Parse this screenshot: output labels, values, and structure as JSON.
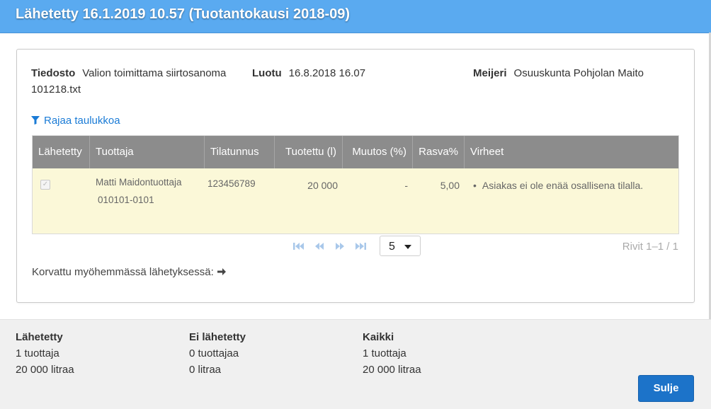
{
  "header": {
    "title": "Lähetetty 16.1.2019 10.57 (Tuotantokausi 2018-09)"
  },
  "meta": {
    "file_label": "Tiedosto",
    "file_value_line1": "Valion toimittama siirtosanoma",
    "file_value_line2": "101218.txt",
    "created_label": "Luotu",
    "created_value": "16.8.2018 16.07",
    "dairy_label": "Meijeri",
    "dairy_value": "Osuuskunta Pohjolan Maito"
  },
  "filter": {
    "label": "Rajaa taulukkoa",
    "icon": "filter-icon"
  },
  "table": {
    "columns": [
      "Lähetetty",
      "Tuottaja",
      "Tilatunnus",
      "Tuotettu (l)",
      "Muutos (%)",
      "Rasva%",
      "Virheet"
    ],
    "rows": [
      {
        "sent_checked": true,
        "producer_name": "Matti Maidontuottaja",
        "producer_id": "010101-0101",
        "farm_id": "123456789",
        "produced": "20 000",
        "change": "-",
        "fat": "5,00",
        "error": "Asiakas ei ole enää osallisena tilalla."
      }
    ]
  },
  "pager": {
    "page_size": "5",
    "rows_info": "Rivit 1–1 / 1",
    "icons": [
      "first-page-icon",
      "prev-page-icon",
      "next-page-icon",
      "last-page-icon"
    ]
  },
  "replaced": {
    "label": "Korvattu myöhemmässä lähetyksessä:",
    "icon": "arrow-right-icon"
  },
  "footer": {
    "sent": {
      "title": "Lähetetty",
      "producers": "1 tuottaja",
      "litres": "20 000 litraa"
    },
    "not_sent": {
      "title": "Ei lähetetty",
      "producers": "0 tuottajaa",
      "litres": "0 litraa"
    },
    "all": {
      "title": "Kaikki",
      "producers": "1 tuottaja",
      "litres": "20 000 litraa"
    },
    "close_label": "Sulje"
  },
  "colors": {
    "header_bg": "#5aaaf0",
    "table_head_bg": "#8c8c8c",
    "row_bg": "#fbf8d8",
    "link": "#1a7bd6",
    "primary_button": "#1c73c9"
  }
}
